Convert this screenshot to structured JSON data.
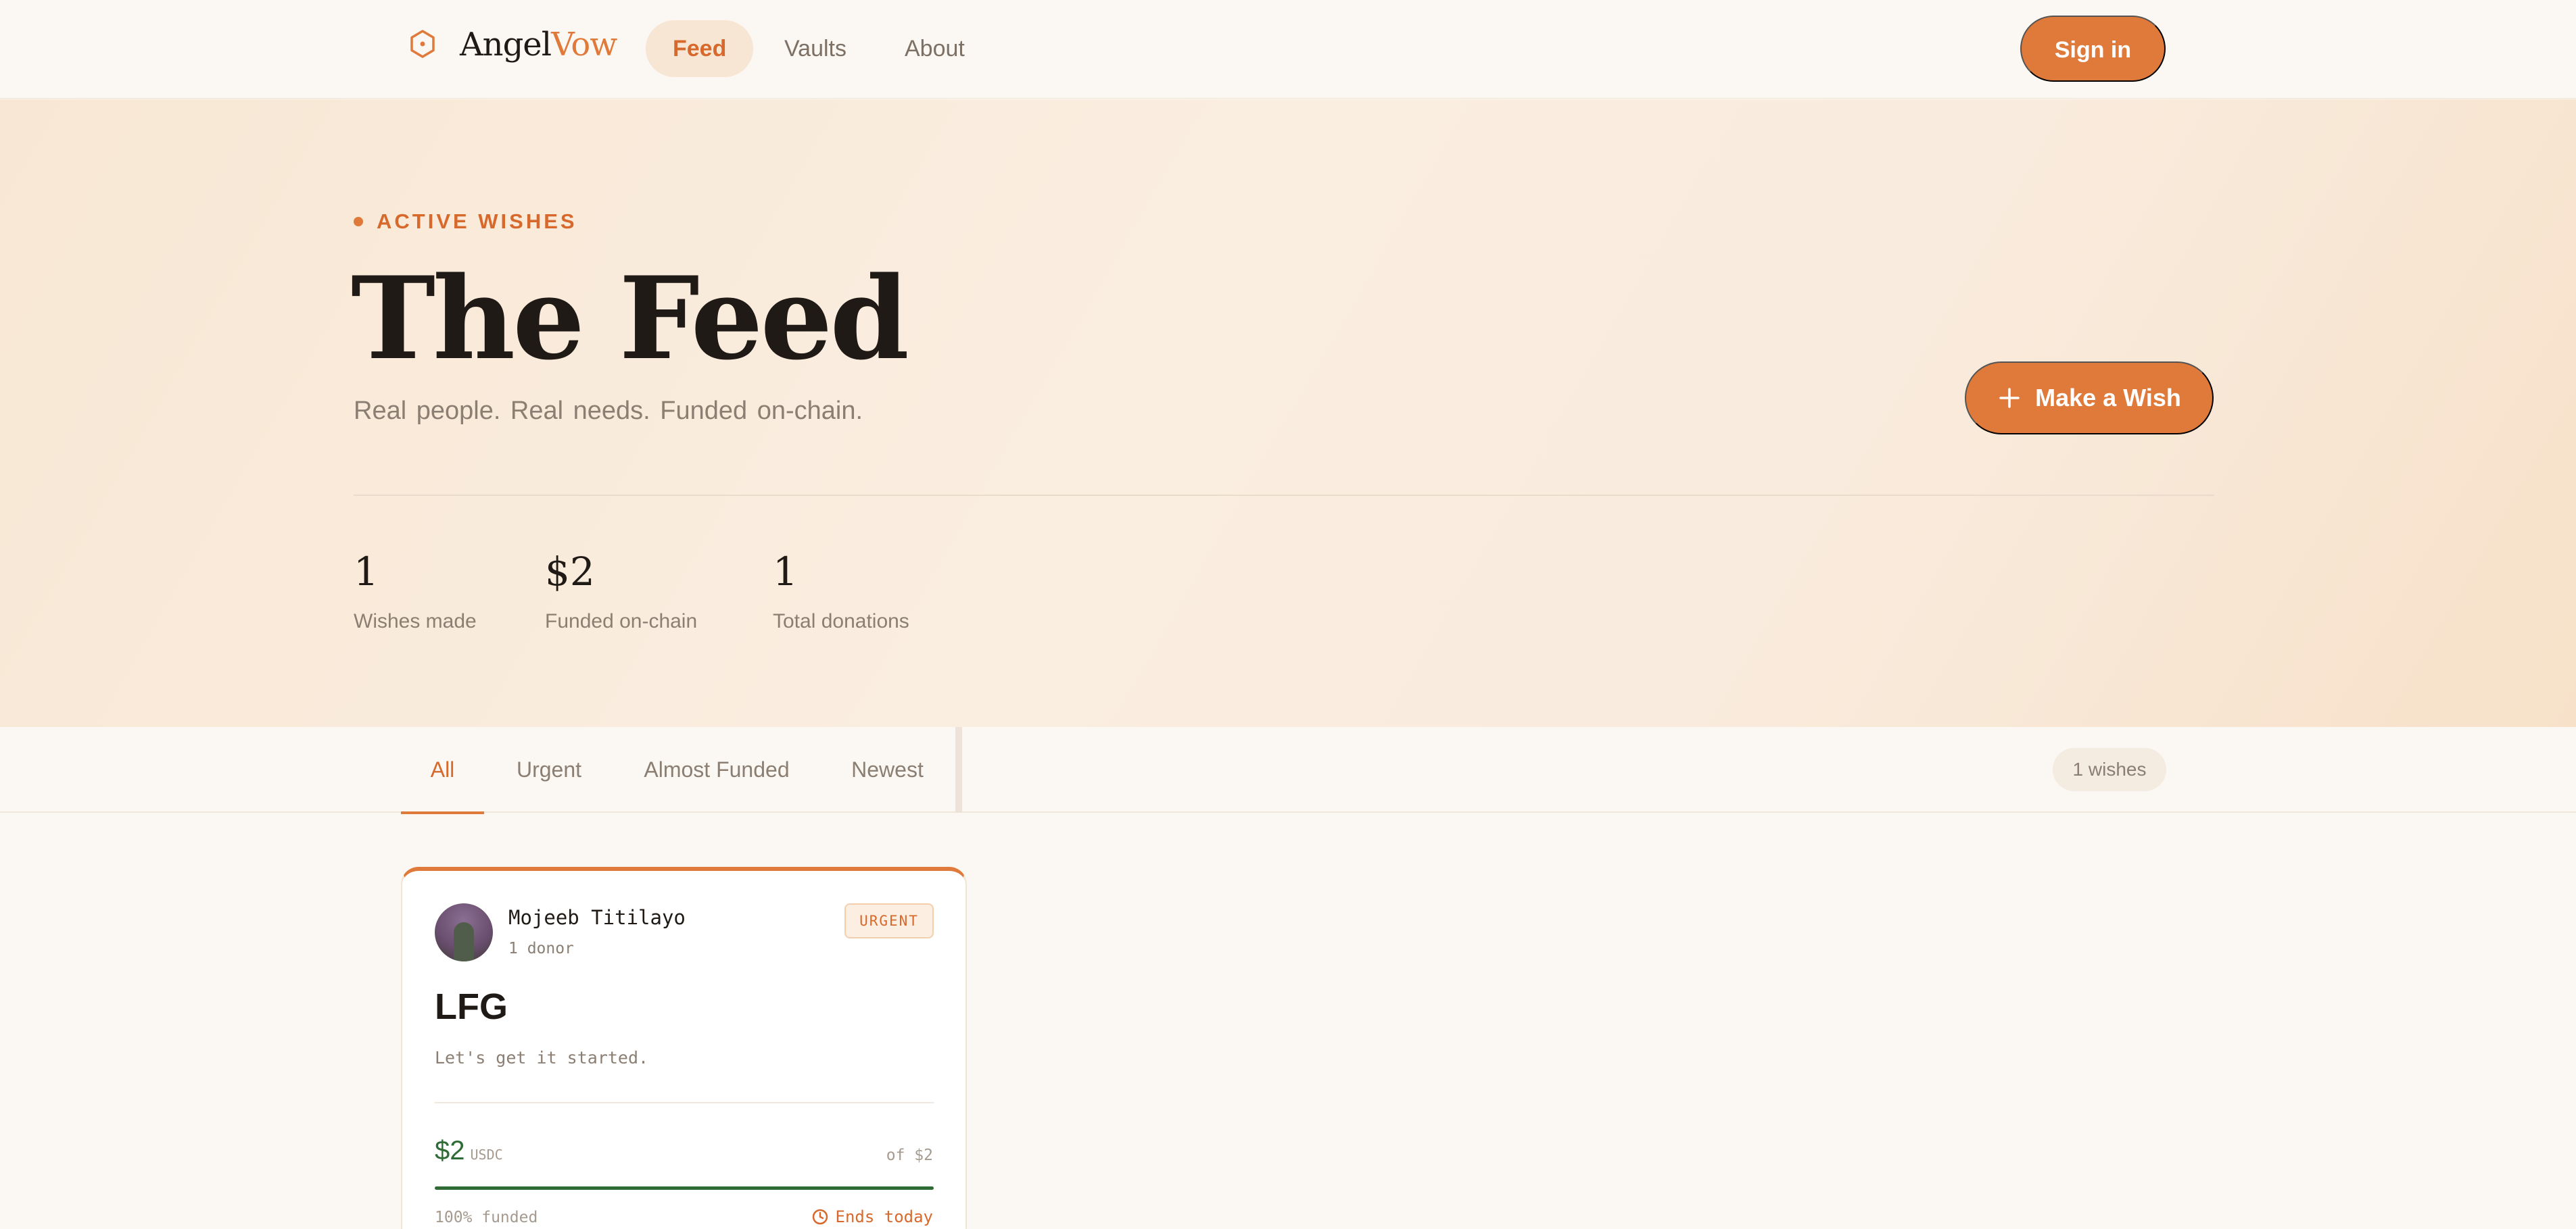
{
  "header": {
    "brand_main": "Angel",
    "brand_accent": "Vow",
    "logo_icon": "hexagon-logo-icon",
    "nav": [
      {
        "label": "Feed",
        "active": true
      },
      {
        "label": "Vaults",
        "active": false
      },
      {
        "label": "About",
        "active": false
      }
    ],
    "signin_label": "Sign in"
  },
  "hero": {
    "eyebrow": "ACTIVE WISHES",
    "title": "The Feed",
    "subtitle": "Real people.  Real needs.  Funded on-chain.",
    "cta_label": "Make a Wish",
    "cta_icon": "plus-icon",
    "stats": [
      {
        "value": "1",
        "label": "Wishes made"
      },
      {
        "value": "$2",
        "label": "Funded on-chain"
      },
      {
        "value": "1",
        "label": "Total donations"
      }
    ]
  },
  "filters": {
    "tabs": [
      {
        "label": "All",
        "active": true
      },
      {
        "label": "Urgent",
        "active": false
      },
      {
        "label": "Almost Funded",
        "active": false
      },
      {
        "label": "Newest",
        "active": false
      }
    ],
    "count_label": "1 wishes"
  },
  "wishes": [
    {
      "user": "Mojeeb Titilayo",
      "donors": "1 donor",
      "badge": "URGENT",
      "title": "LFG",
      "description": "Let's get it started.",
      "raised": "$2",
      "currency": "USDC",
      "goal": "of $2",
      "progress": 1.0,
      "funded_label": "100% funded",
      "ends_label": "Ends today",
      "ends_icon": "clock-icon"
    }
  ],
  "colors": {
    "accent": "#e07a3a",
    "accent_text": "#d7692c",
    "success": "#2f6b35",
    "background": "#fbf7f2"
  }
}
